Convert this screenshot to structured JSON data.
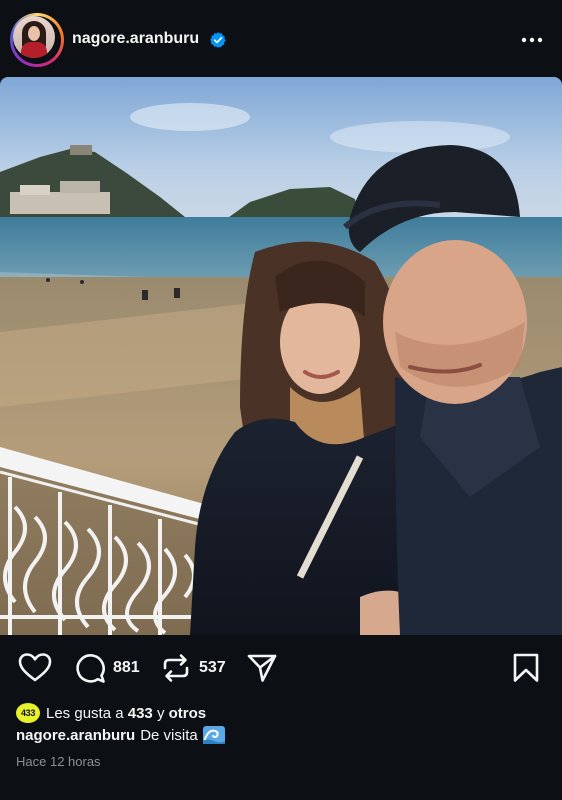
{
  "post": {
    "username": "nagore.aranburu",
    "verified": true,
    "comments_count": "881",
    "shares_count": "537",
    "likes_prefix": "Les gusta a",
    "likes_account": "433",
    "likes_connector": "y",
    "likes_suffix": "otros",
    "liker_badge_text": "433",
    "caption_user": "nagore.aranburu",
    "caption_text": "De visita",
    "caption_emoji": "wave-icon",
    "timestamp": "Hace 12 horas"
  },
  "icons": {
    "like": "heart-icon",
    "comment": "comment-icon",
    "repost": "repost-icon",
    "share": "send-icon",
    "save": "bookmark-icon",
    "more": "more-icon",
    "verified": "verified-badge-icon"
  },
  "colors": {
    "background": "#0c1014",
    "text": "#f5f5f5",
    "muted": "#8e8e93",
    "verified": "#0095f6",
    "badge": "#e8f22a"
  }
}
